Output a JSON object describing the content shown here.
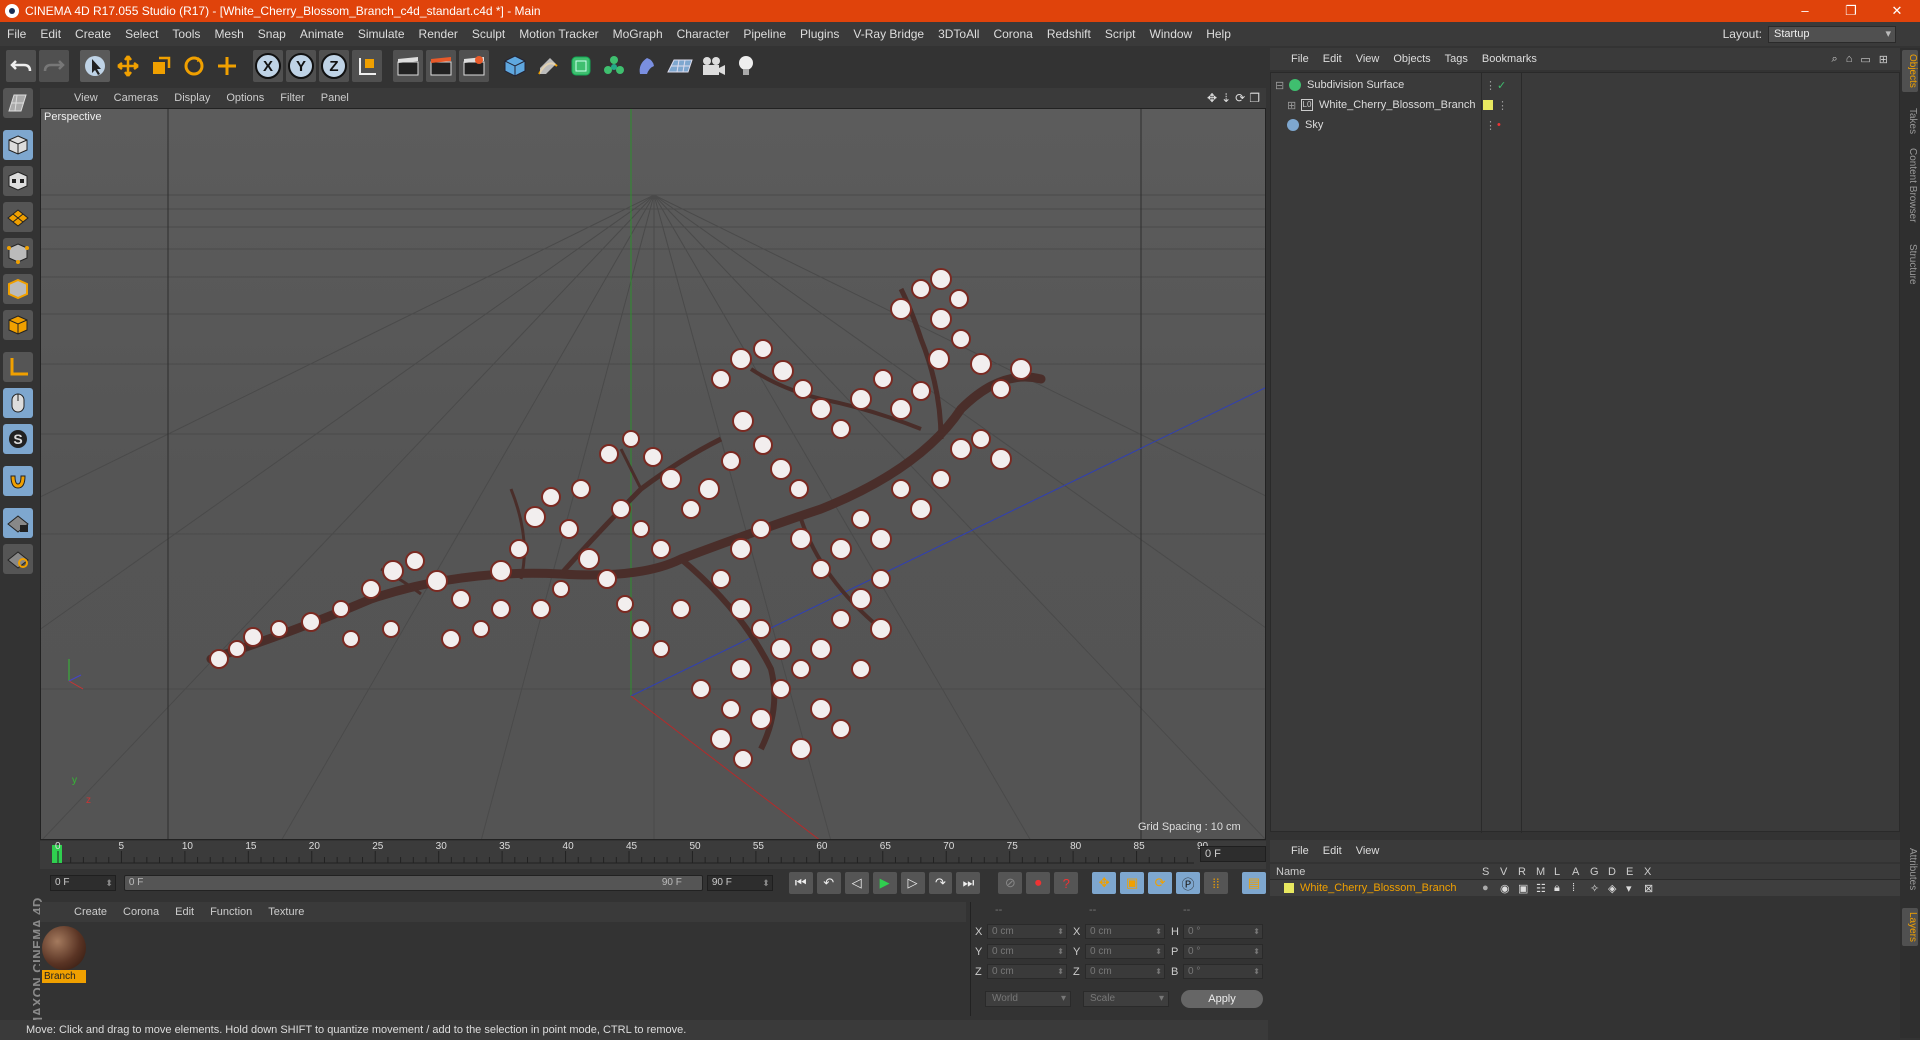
{
  "window": {
    "title": "CINEMA 4D R17.055 Studio (R17) - [White_Cherry_Blossom_Branch_c4d_standart.c4d *] - Main",
    "controls": [
      "–",
      "❐",
      "✕"
    ]
  },
  "menubar": {
    "items": [
      "File",
      "Edit",
      "Create",
      "Select",
      "Tools",
      "Mesh",
      "Snap",
      "Animate",
      "Simulate",
      "Render",
      "Sculpt",
      "Motion Tracker",
      "MoGraph",
      "Character",
      "Pipeline",
      "Plugins",
      "V-Ray Bridge",
      "3DToAll",
      "Corona",
      "Redshift",
      "Script",
      "Window",
      "Help"
    ],
    "layout_label": "Layout:",
    "layout_value": "Startup"
  },
  "toolbar": {
    "axis": [
      "X",
      "Y",
      "Z"
    ]
  },
  "viewport": {
    "menu": [
      "View",
      "Cameras",
      "Display",
      "Options",
      "Filter",
      "Panel"
    ],
    "camera_label": "Perspective",
    "grid_spacing": "Grid Spacing : 10 cm",
    "axis_y": "y",
    "axis_z": "z"
  },
  "timeline": {
    "ticks": [
      "0",
      "5",
      "10",
      "15",
      "20",
      "25",
      "30",
      "35",
      "40",
      "45",
      "50",
      "55",
      "60",
      "65",
      "70",
      "75",
      "80",
      "85",
      "90"
    ],
    "current_frame": "0 F",
    "start_field": "0 F",
    "range_start": "0 F",
    "range_end": "90 F",
    "end_field": "90 F"
  },
  "material_manager": {
    "menu": [
      "Create",
      "Corona",
      "Edit",
      "Function",
      "Texture"
    ],
    "material_name": "Branch"
  },
  "coordinates": {
    "headers": [
      "--",
      "--",
      "--"
    ],
    "rows": [
      {
        "l1": "X",
        "v1": "0 cm",
        "l2": "X",
        "v2": "0 cm",
        "l3": "H",
        "v3": "0 °"
      },
      {
        "l1": "Y",
        "v1": "0 cm",
        "l2": "Y",
        "v2": "0 cm",
        "l3": "P",
        "v3": "0 °"
      },
      {
        "l1": "Z",
        "v1": "0 cm",
        "l2": "Z",
        "v2": "0 cm",
        "l3": "B",
        "v3": "0 °"
      }
    ],
    "mode": "World",
    "size_mode": "Scale",
    "apply": "Apply"
  },
  "status": "Move: Click and drag to move elements. Hold down SHIFT to quantize movement / add to the selection in point mode, CTRL to remove.",
  "object_manager": {
    "menu": [
      "File",
      "Edit",
      "View",
      "Objects",
      "Tags",
      "Bookmarks"
    ],
    "objects": [
      {
        "name": "Subdivision Surface",
        "icon_color": "#3fbf6f"
      },
      {
        "name": "White_Cherry_Blossom_Branch",
        "icon_color": "#9acd32"
      },
      {
        "name": "Sky",
        "icon_color": "#7ea7cf"
      }
    ]
  },
  "right_tabs": [
    "Objects",
    "Takes",
    "Content Browser",
    "Structure",
    "Attributes",
    "Layers"
  ],
  "layer_manager": {
    "menu": [
      "File",
      "Edit",
      "View"
    ],
    "columns": [
      "Name",
      "S",
      "V",
      "R",
      "M",
      "L",
      "A",
      "G",
      "D",
      "E",
      "X"
    ],
    "layer_name": "White_Cherry_Blossom_Branch"
  },
  "logo": "MAXON CINEMA 4D",
  "colors": {
    "titlebar": "#e0430b",
    "accent_blue": "#7ea7cf",
    "accent_orange": "#f0a000"
  }
}
